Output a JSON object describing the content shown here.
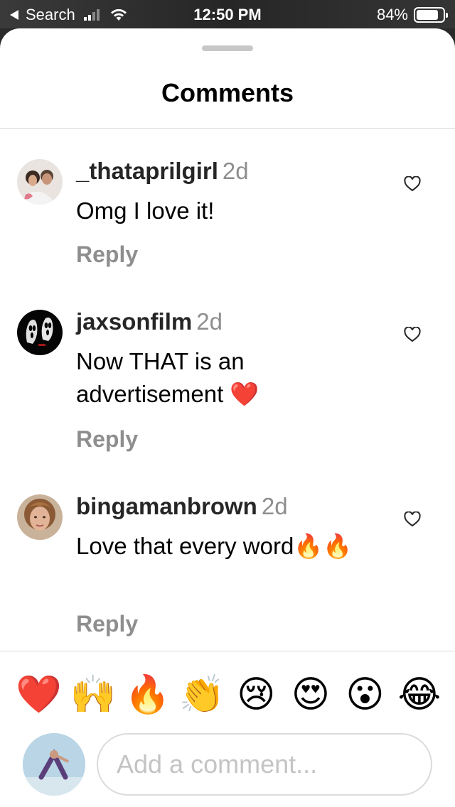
{
  "status_bar": {
    "back_label": "Search",
    "time": "12:50 PM",
    "battery": "84%",
    "battery_level": 0.84
  },
  "sheet": {
    "title": "Comments"
  },
  "comments": [
    {
      "username": "_thataprilgirl",
      "time": "2d",
      "text": "Omg I love it!",
      "reply": "Reply",
      "avatar": "avatar-couple-photo"
    },
    {
      "username": "jaxsonfilm",
      "time": "2d",
      "text": "Now THAT is an advertisement ❤️",
      "reply": "Reply",
      "avatar": "avatar-ghostface-masks"
    },
    {
      "username": "bingamanbrown",
      "time": "2d",
      "text": "Love that every word🔥🔥",
      "reply": "Reply",
      "avatar": "avatar-woman-photo"
    }
  ],
  "quick_reactions": [
    "❤️",
    "🙌",
    "🔥",
    "👏",
    "😢",
    "😍",
    "😮",
    "😂"
  ],
  "composer": {
    "placeholder": "Add a comment...",
    "value": ""
  },
  "colors": {
    "accent_text": "#262626",
    "muted": "#8e8e8e",
    "divider": "#dbdbdb"
  }
}
